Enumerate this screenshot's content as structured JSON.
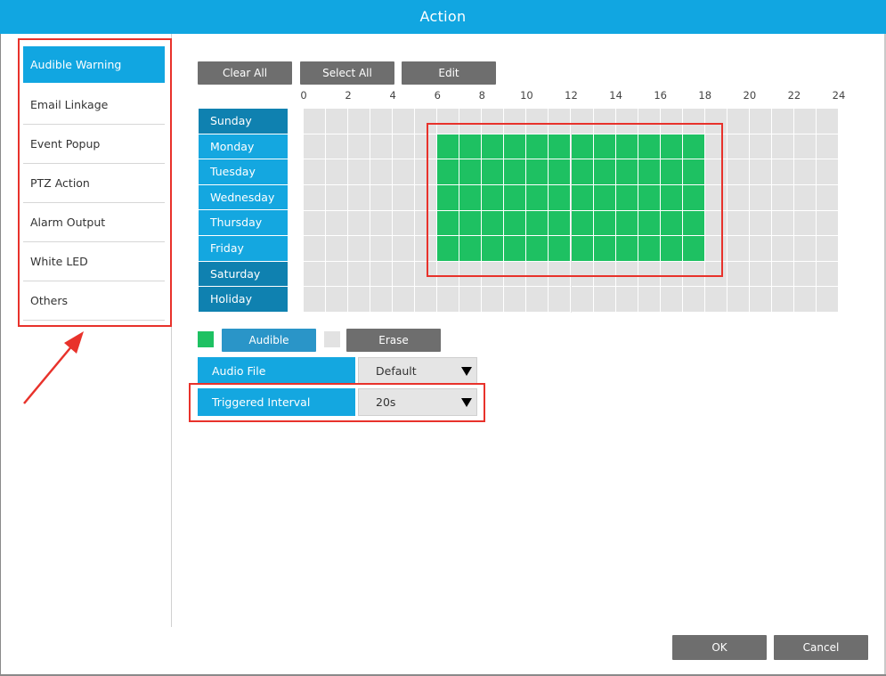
{
  "window": {
    "title": "Action"
  },
  "sidebar": {
    "items": [
      {
        "label": "Audible Warning",
        "active": true
      },
      {
        "label": "Email Linkage",
        "active": false
      },
      {
        "label": "Event Popup",
        "active": false
      },
      {
        "label": "PTZ Action",
        "active": false
      },
      {
        "label": "Alarm Output",
        "active": false
      },
      {
        "label": "White LED",
        "active": false
      },
      {
        "label": "Others",
        "active": false
      }
    ]
  },
  "toolbar": {
    "clear_all": "Clear All",
    "select_all": "Select All",
    "edit": "Edit"
  },
  "schedule": {
    "hour_labels": [
      "0",
      "2",
      "4",
      "6",
      "8",
      "10",
      "12",
      "14",
      "16",
      "18",
      "20",
      "22",
      "24"
    ],
    "days": [
      "Sunday",
      "Monday",
      "Tuesday",
      "Wednesday",
      "Thursday",
      "Friday",
      "Saturday",
      "Holiday"
    ],
    "active_days": [
      "Monday",
      "Tuesday",
      "Wednesday",
      "Thursday",
      "Friday"
    ],
    "active_hours": {
      "start": 6,
      "end": 18
    },
    "colors": {
      "active": "#1ec162",
      "inactive": "#e2e2e2"
    }
  },
  "legend": {
    "audible_label": "Audible",
    "erase_label": "Erase"
  },
  "audio_file": {
    "label": "Audio File",
    "value": "Default"
  },
  "triggered_interval": {
    "label": "Triggered Interval",
    "value": "20s"
  },
  "footer": {
    "ok_label": "OK",
    "cancel_label": "Cancel"
  },
  "colors": {
    "accent": "#11a6e1",
    "highlight_box": "#e8322b",
    "button_gray": "#6e6e6e"
  }
}
